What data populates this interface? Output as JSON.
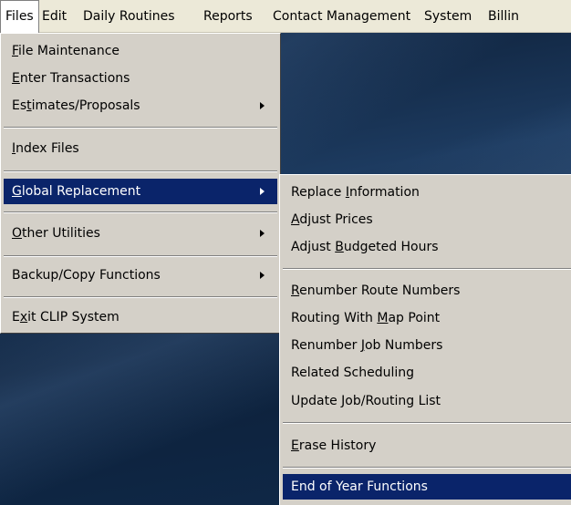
{
  "menubar": {
    "items": [
      "Files",
      "Edit",
      "Daily Routines",
      "Reports",
      "Contact Management",
      "System",
      "Billin"
    ]
  },
  "files_menu": {
    "items": [
      {
        "pre": "",
        "key": "F",
        "post": "ile Maintenance"
      },
      {
        "pre": "",
        "key": "E",
        "post": "nter Transactions"
      },
      {
        "pre": "Es",
        "key": "t",
        "post": "imates/Proposals"
      },
      {
        "pre": "",
        "key": "I",
        "post": "ndex Files"
      },
      {
        "pre": "",
        "key": "G",
        "post": "lobal Replacement"
      },
      {
        "pre": "",
        "key": "O",
        "post": "ther Utilities"
      },
      {
        "pre": "Backup/Copy Functions",
        "key": "",
        "post": ""
      },
      {
        "pre": "E",
        "key": "x",
        "post": "it CLIP System"
      }
    ]
  },
  "global_submenu": {
    "items": [
      {
        "pre": "Replace ",
        "key": "I",
        "post": "nformation"
      },
      {
        "pre": "",
        "key": "A",
        "post": "djust Prices"
      },
      {
        "pre": "Adjust ",
        "key": "B",
        "post": "udgeted Hours"
      },
      {
        "pre": "",
        "key": "R",
        "post": "enumber Route Numbers"
      },
      {
        "pre": "Routing With ",
        "key": "M",
        "post": "ap Point"
      },
      {
        "pre": "Renumber ",
        "key": "J",
        "post": "ob Numbers"
      },
      {
        "pre": "Related Scheduling",
        "key": "",
        "post": ""
      },
      {
        "pre": "Update Job/Routing List",
        "key": "",
        "post": ""
      },
      {
        "pre": "",
        "key": "E",
        "post": "rase History"
      },
      {
        "pre": "End of Year Functions",
        "key": "",
        "post": ""
      }
    ]
  }
}
